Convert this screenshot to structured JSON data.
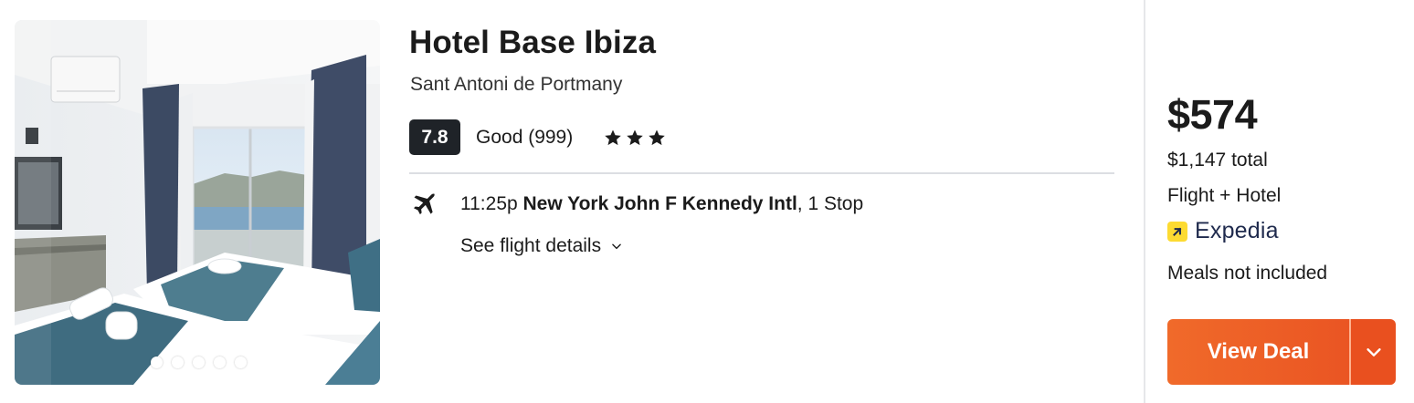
{
  "hotel": {
    "name": "Hotel Base Ibiza",
    "location": "Sant Antoni de Portmany",
    "score": "7.8",
    "rating_text": "Good (999)",
    "stars": 3,
    "photo_count": 5,
    "active_photo": 1
  },
  "flight": {
    "time": "11:25p",
    "airport": "New York John F Kennedy Intl",
    "stops": ", 1 Stop",
    "details_label": "See flight details"
  },
  "pricing": {
    "price": "$574",
    "total": "$1,147 total",
    "package": "Flight + Hotel",
    "provider": "Expedia",
    "meals": "Meals not included",
    "cta": "View Deal"
  },
  "icons": {
    "plane": "plane-icon",
    "star": "star-icon",
    "chevron": "chevron-down-icon",
    "provider_logo": "expedia-logo-icon"
  },
  "colors": {
    "score_bg": "#1f2328",
    "cta": "#ea5523",
    "expedia_yellow": "#fddb32"
  }
}
